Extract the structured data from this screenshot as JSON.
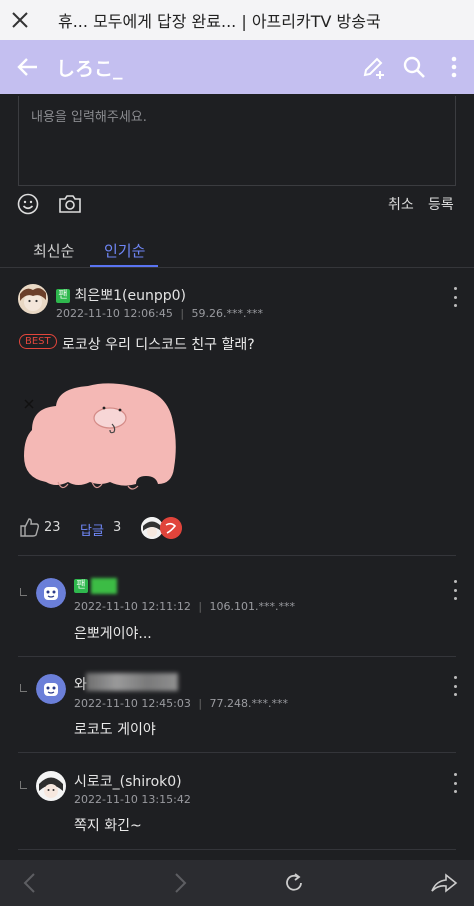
{
  "browser": {
    "title": "휴... 모두에게 답장 완료... | 아프리카TV 방송국"
  },
  "header": {
    "channel_name": "しろこ_"
  },
  "input": {
    "placeholder": "내용을 입력해주세요."
  },
  "toolbar": {
    "cancel_label": "취소",
    "submit_label": "등록"
  },
  "tabs": [
    {
      "label": "최신순",
      "active": false
    },
    {
      "label": "인기순",
      "active": true
    }
  ],
  "post": {
    "fan_badge": "팬",
    "author": "최은뽀1(eunpp0)",
    "date": "2022-11-10 12:06:45",
    "ip": "59.26.***.***",
    "best_label": "BEST",
    "text": "로코상 우리 디스코드 친구 할래?",
    "likes": "23",
    "reply_label": "답글",
    "reply_count": "3"
  },
  "replies": [
    {
      "fan_badge": "팬",
      "author": "",
      "date": "2022-11-10 12:11:12",
      "ip": "106.101.***.***",
      "text": "은뽀게이야..."
    },
    {
      "author": "와",
      "date": "2022-11-10 12:45:03",
      "ip": "77.248.***.***",
      "text": "로코도 게이야"
    },
    {
      "author": "시로코_(shirok0)",
      "date": "2022-11-10 13:15:42",
      "text": "쪽지 화긴~"
    }
  ],
  "colors": {
    "accent": "#5a74f2",
    "header_bg": "#c4bff0",
    "best": "#e2463c",
    "fan": "#2fb84e"
  }
}
